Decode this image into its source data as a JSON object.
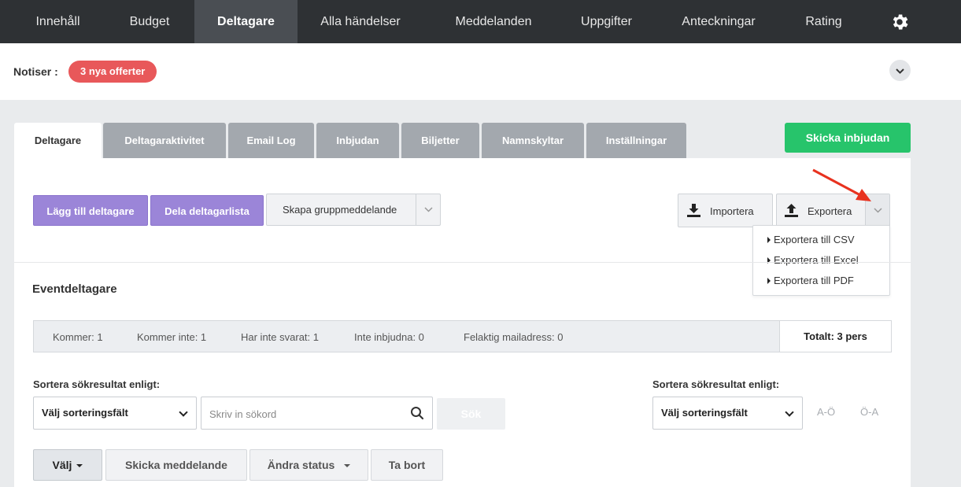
{
  "nav": {
    "items": [
      "Innehåll",
      "Budget",
      "Deltagare",
      "Alla händelser",
      "Meddelanden",
      "Uppgifter",
      "Anteckningar",
      "Rating"
    ],
    "active_index": 2,
    "settings_icon": "gear-icon"
  },
  "notices": {
    "label": "Notiser :",
    "badge": "3 nya offerter",
    "badge_color": "#e8585a"
  },
  "tabs": {
    "items": [
      "Deltagare",
      "Deltagaraktivitet",
      "Email Log",
      "Inbjudan",
      "Biljetter",
      "Namnskyltar",
      "Inställningar"
    ],
    "active_index": 0
  },
  "invite_button": "Skicka inbjudan",
  "toolbar": {
    "add_participant": "Lägg till deltagare",
    "share_list": "Dela deltagarlista",
    "group_message": "Skapa gruppmeddelande",
    "import": "Importera",
    "export": "Exportera"
  },
  "export_menu": [
    "Exportera till CSV",
    "Exportera till Excel",
    "Exportera till PDF"
  ],
  "section_title": "Eventdeltagare",
  "stats": {
    "coming": "Kommer: 1",
    "not_coming": "Kommer inte: 1",
    "no_reply": "Har inte svarat: 1",
    "not_invited": "Inte inbjudna: 0",
    "bad_email": "Felaktig mailadress: 0",
    "total": "Totalt: 3 pers"
  },
  "filters": {
    "sort_label_left": "Sortera sökresultat enligt:",
    "sort_label_right": "Sortera sökresultat enligt:",
    "sort_select_left": "Välj sorteringsfält",
    "sort_select_right": "Välj sorteringsfält",
    "search_placeholder": "Skriv in sökord",
    "search_button": "Sök",
    "az": "A-Ö",
    "za": "Ö-A"
  },
  "actions": {
    "select": "Välj",
    "send_message": "Skicka meddelande",
    "change_status": "Ändra status",
    "delete": "Ta bort"
  },
  "colors": {
    "nav_bg": "#2e3134",
    "purple": "#9b85d8",
    "green": "#27c46b",
    "annotation_arrow": "#e8321f"
  }
}
